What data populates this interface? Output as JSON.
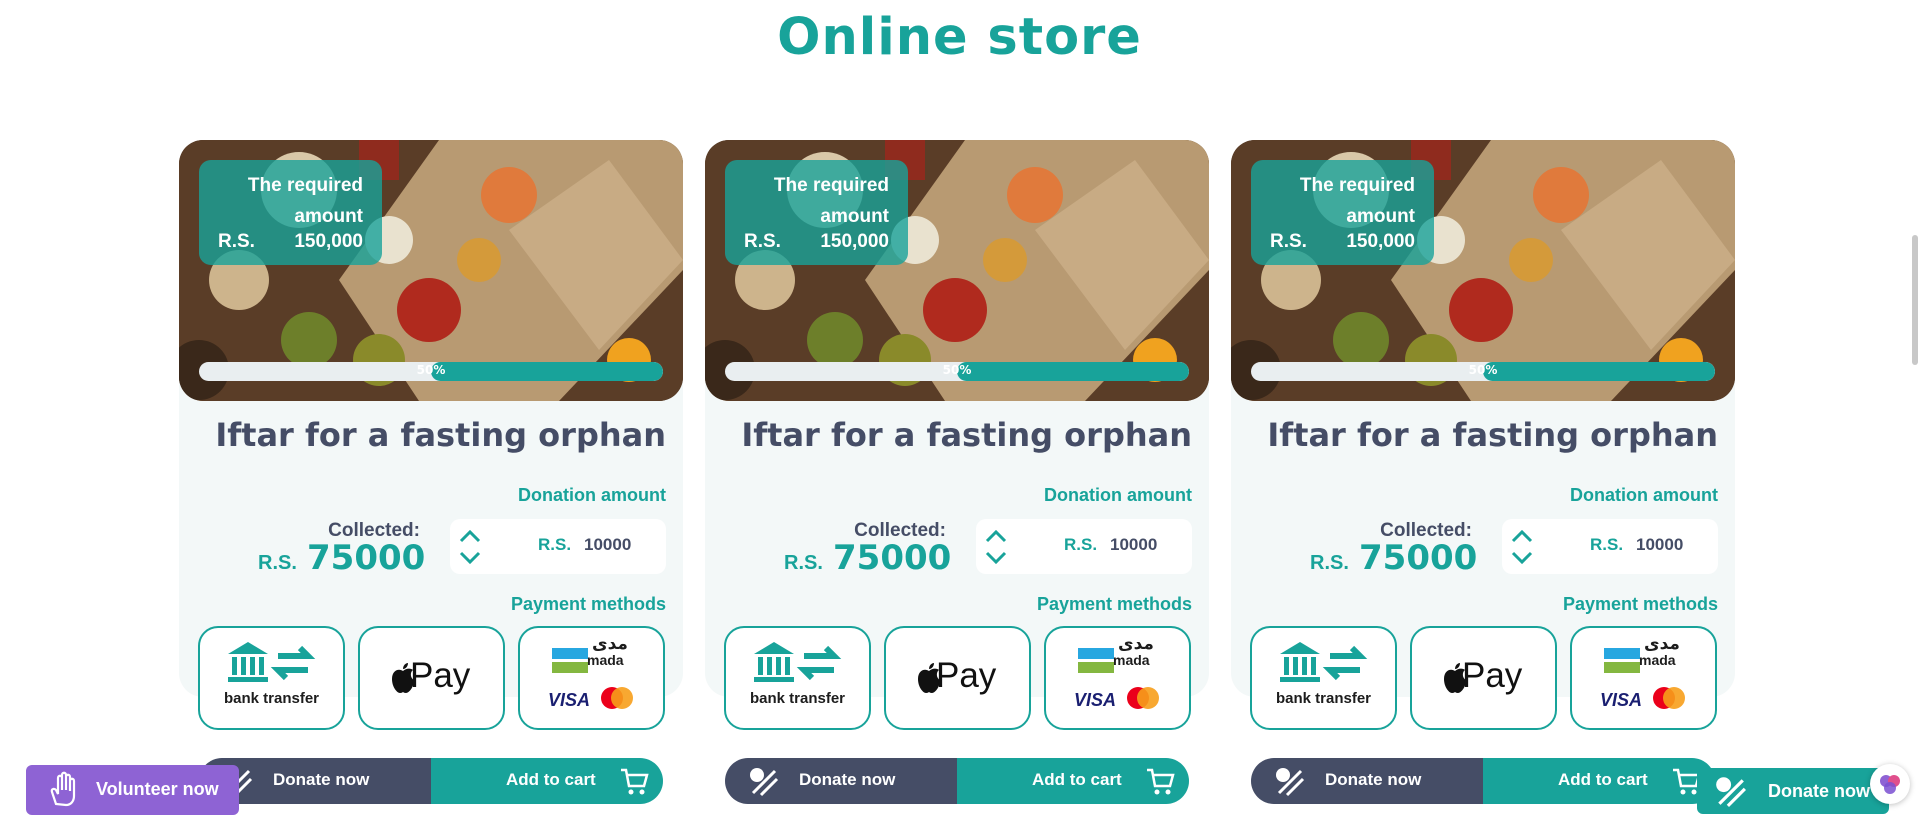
{
  "page": {
    "title": "Online store"
  },
  "colors": {
    "accent": "#18a39a",
    "dark": "#454d66",
    "volunteer": "#8e63d4"
  },
  "cards": [
    {
      "required_label": "The required amount",
      "required_currency": "R.S.",
      "required_value": "150,000",
      "progress_label": "50%",
      "progress_fraction": 0.5,
      "title": "Iftar for a fasting orphan",
      "donation_label": "Donation amount",
      "collected_label": "Collected:",
      "collected_currency": "R.S.",
      "collected_value": "75000",
      "input_currency": "R.S.",
      "input_value": "10000",
      "payment_label": "Payment methods",
      "payment": {
        "bank": "bank transfer",
        "apple": "Pay",
        "mada": "mada",
        "mada_ar": "مدى",
        "visa": "VISA"
      },
      "donate_label": "Donate now",
      "cart_label": "Add to cart"
    },
    {
      "required_label": "The required amount",
      "required_currency": "R.S.",
      "required_value": "150,000",
      "progress_label": "50%",
      "progress_fraction": 0.5,
      "title": "Iftar for a fasting orphan",
      "donation_label": "Donation amount",
      "collected_label": "Collected:",
      "collected_currency": "R.S.",
      "collected_value": "75000",
      "input_currency": "R.S.",
      "input_value": "10000",
      "payment_label": "Payment methods",
      "payment": {
        "bank": "bank transfer",
        "apple": "Pay",
        "mada": "mada",
        "mada_ar": "مدى",
        "visa": "VISA"
      },
      "donate_label": "Donate now",
      "cart_label": "Add to cart"
    },
    {
      "required_label": "The required amount",
      "required_currency": "R.S.",
      "required_value": "150,000",
      "progress_label": "50%",
      "progress_fraction": 0.5,
      "title": "Iftar for a fasting orphan",
      "donation_label": "Donation amount",
      "collected_label": "Collected:",
      "collected_currency": "R.S.",
      "collected_value": "75000",
      "input_currency": "R.S.",
      "input_value": "10000",
      "payment_label": "Payment methods",
      "payment": {
        "bank": "bank transfer",
        "apple": "Pay",
        "mada": "mada",
        "mada_ar": "مدى",
        "visa": "VISA"
      },
      "donate_label": "Donate now",
      "cart_label": "Add to cart"
    }
  ],
  "floating": {
    "volunteer_label": "Volunteer now",
    "donate_label": "Donate now",
    "icons": [
      "hand-icon",
      "donate-icon",
      "ai-brain-icon"
    ]
  }
}
